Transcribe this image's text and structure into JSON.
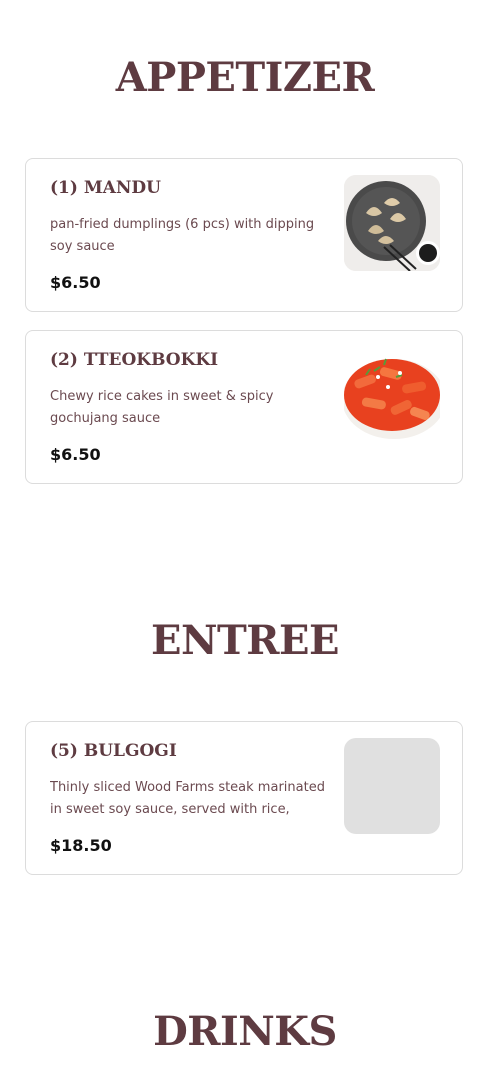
{
  "sections": {
    "appetizer": {
      "title": "APPETIZER",
      "items": [
        {
          "name": "(1) MANDU",
          "description": "pan-fried dumplings (6 pcs) with dipping soy sauce",
          "price": "$6.50",
          "image": "dumplings-photo"
        },
        {
          "name": "(2) TTEOKBOKKI",
          "description": "Chewy rice cakes in sweet & spicy gochujang sauce",
          "price": "$6.50",
          "image": "tteokbokki-photo"
        }
      ]
    },
    "entree": {
      "title": "ENTREE",
      "items": [
        {
          "name": "(5) BULGOGI",
          "description": "Thinly sliced Wood Farms steak marinated in sweet soy sauce, served with rice, kimchi,...",
          "price": "$18.50",
          "image": "image-placeholder"
        }
      ]
    },
    "drinks": {
      "title": "DRINKS"
    }
  },
  "colors": {
    "heading": "#5e3b41",
    "description": "#6b4a50",
    "price": "#111111",
    "card_border": "#dcdcdc",
    "placeholder": "#e0e0e0"
  }
}
